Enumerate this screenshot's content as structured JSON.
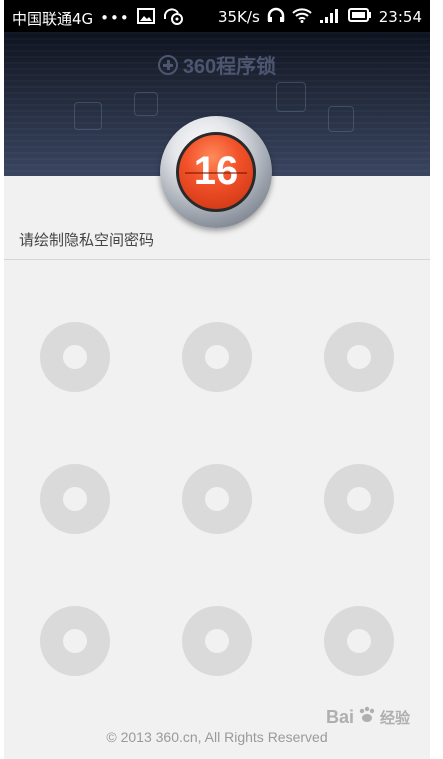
{
  "status_bar": {
    "carrier": "中国联通4G",
    "dots": "•••",
    "speed": "35K/s",
    "time": "23:54",
    "icons": [
      "image-icon",
      "headset-sync-icon",
      "headphones-icon",
      "wifi-icon",
      "signal-icon",
      "battery-icon"
    ]
  },
  "header": {
    "brand": "360程序锁"
  },
  "badge": {
    "number": "16"
  },
  "prompt": "请绘制隐私空间密码",
  "pattern": {
    "nodes": [
      "1",
      "2",
      "3",
      "4",
      "5",
      "6",
      "7",
      "8",
      "9"
    ]
  },
  "footer": "© 2013 360.cn, All Rights Reserved",
  "watermark": {
    "text": "Bai",
    "text2": "经验"
  },
  "colors": {
    "header_dark": "#1f2636",
    "badge_red": "#f2522a",
    "dot_gray": "#dadada",
    "background": "#f1f1f1"
  }
}
